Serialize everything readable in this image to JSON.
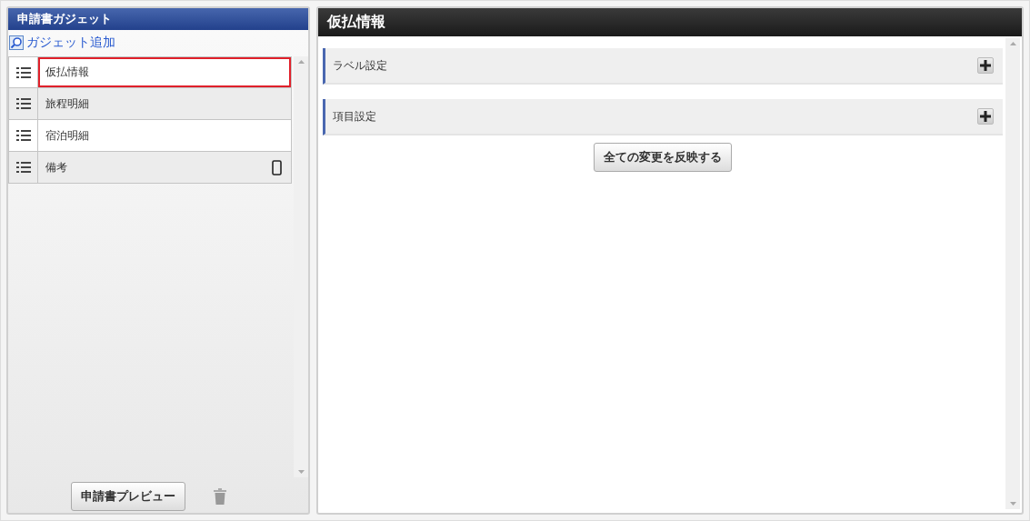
{
  "left_panel": {
    "title": "申請書ガジェット",
    "add_link": "ガジェット追加",
    "items": [
      {
        "label": "仮払情報",
        "selected": true,
        "mobile": false
      },
      {
        "label": "旅程明細",
        "selected": false,
        "mobile": false
      },
      {
        "label": "宿泊明細",
        "selected": false,
        "mobile": false
      },
      {
        "label": "備考",
        "selected": false,
        "mobile": true
      }
    ],
    "preview_button": "申請書プレビュー"
  },
  "right_panel": {
    "title": "仮払情報",
    "sections": [
      {
        "label": "ラベル設定",
        "expanded": false
      },
      {
        "label": "項目設定",
        "expanded": false
      }
    ],
    "apply_button": "全ての変更を反映する"
  }
}
